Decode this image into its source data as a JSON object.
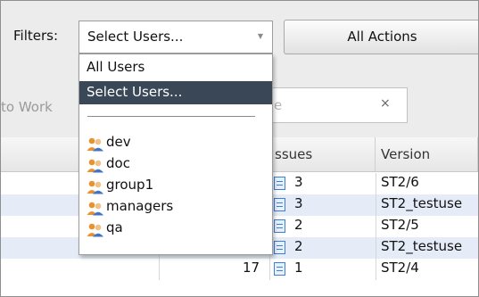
{
  "toolbar": {
    "filters_label": "Filters:",
    "select": {
      "value": "Select Users...",
      "arrow_icon": "chevron-down-icon"
    },
    "actions_label": "All Actions"
  },
  "row2": {
    "work_text": "to Work",
    "search_partial": "e",
    "clear_glyph": "×"
  },
  "table": {
    "columns": [
      "ssues",
      "Version"
    ],
    "rows": [
      {
        "issues": "3",
        "version": "ST2/6"
      },
      {
        "issues": "3",
        "version": "ST2_testuse"
      },
      {
        "issues": "2",
        "version": "ST2/5"
      },
      {
        "issues": "2",
        "version": "ST2_testuse"
      },
      {
        "left": "17",
        "issues": "1",
        "version": "ST2/4"
      }
    ]
  },
  "dropdown": {
    "options": [
      {
        "label": "All Users",
        "selected": false
      },
      {
        "label": "Select Users...",
        "selected": true
      }
    ],
    "groups": [
      {
        "label": "dev",
        "icon": "group-icon"
      },
      {
        "label": "doc",
        "icon": "group-icon"
      },
      {
        "label": "group1",
        "icon": "group-icon"
      },
      {
        "label": "managers",
        "icon": "group-icon"
      },
      {
        "label": "qa",
        "icon": "group-icon"
      }
    ]
  },
  "colors": {
    "selected_bg": "#3a4756",
    "row_alt": "#e6ecf7",
    "toolbar_bg": "#ececec",
    "group_icon_orange": "#e8922f",
    "group_icon_blue": "#3f74c9"
  }
}
